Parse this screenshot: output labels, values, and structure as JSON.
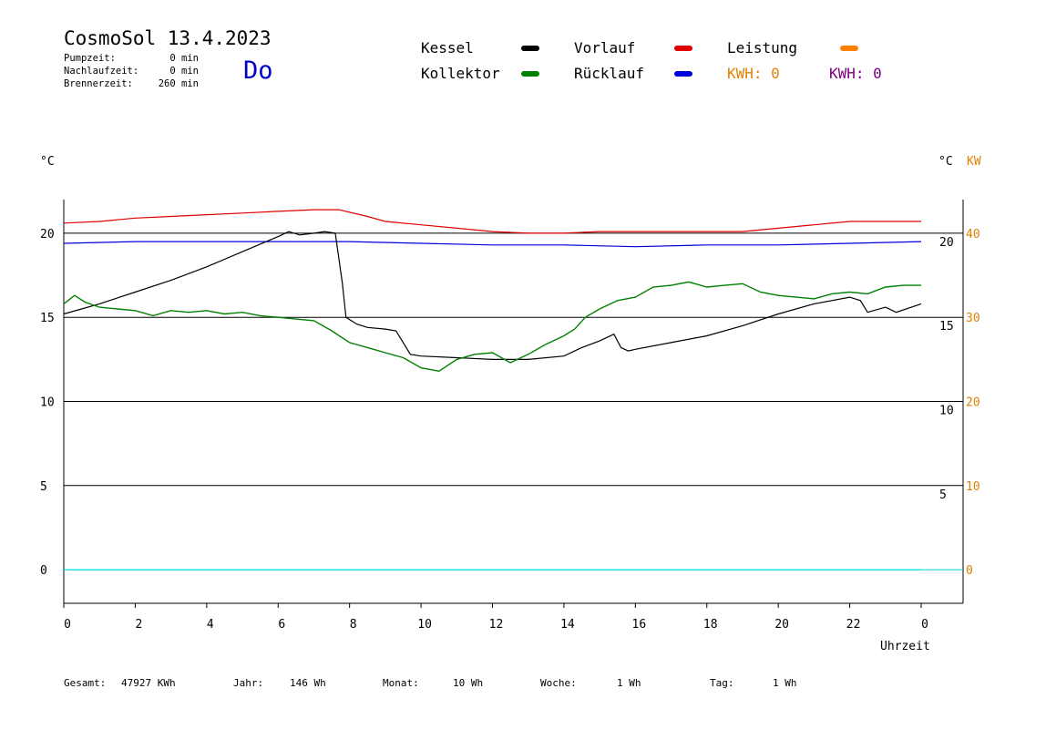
{
  "header": {
    "title": "CosmoSol 13.4.2023",
    "weekday": "Do",
    "stats": [
      {
        "label": "Pumpzeit:",
        "value": "0 min"
      },
      {
        "label": "Nachlaufzeit:",
        "value": "0 min"
      },
      {
        "label": "Brennerzeit:",
        "value": "260 min"
      }
    ]
  },
  "legend": {
    "kessel": {
      "label": "Kessel",
      "color": "#000000"
    },
    "kollektor": {
      "label": "Kollektor",
      "color": "#008000"
    },
    "vorlauf": {
      "label": "Vorlauf",
      "color": "#e00000"
    },
    "ruecklauf": {
      "label": "Rücklauf",
      "color": "#0000dd"
    },
    "leistung": {
      "label": "Leistung",
      "color": "#ff8000"
    },
    "kwh1": {
      "label": "KWH: 0",
      "color": "#e08000"
    },
    "kwh2": {
      "label": "KWH: 0",
      "color": "#800080"
    }
  },
  "footer": {
    "gesamt_label": "Gesamt:",
    "gesamt_value": "47927 KWh",
    "jahr_label": "Jahr:",
    "jahr_value": "146 Wh",
    "monat_label": "Monat:",
    "monat_value": "10 Wh",
    "woche_label": "Woche:",
    "woche_value": "1 Wh",
    "tag_label": "Tag:",
    "tag_value": "1 Wh"
  },
  "chart_data": {
    "type": "line",
    "xlabel": "Uhrzeit",
    "y_left_unit": "°C",
    "y_right_unit": "°C",
    "y_right2_unit": "KW",
    "xlim": [
      0,
      24
    ],
    "ylim": [
      -2,
      22
    ],
    "x_ticks": [
      0,
      2,
      4,
      6,
      8,
      10,
      12,
      14,
      16,
      18,
      20,
      22,
      24
    ],
    "x_tick_labels": [
      "0",
      "2",
      "4",
      "6",
      "8",
      "10",
      "12",
      "14",
      "16",
      "18",
      "20",
      "22",
      "0"
    ],
    "y_left_ticks": [
      0,
      5,
      10,
      15,
      20
    ],
    "y_right_ticks": [
      5,
      10,
      15,
      20
    ],
    "y_right2_ticks": [
      0,
      10,
      20,
      30,
      40
    ],
    "grid_y": [
      0,
      5,
      10,
      15,
      20
    ],
    "series": [
      {
        "name": "Vorlauf",
        "color": "#e00000",
        "x": [
          0,
          1,
          2,
          3,
          4,
          5,
          6,
          7,
          7.7,
          8.5,
          9,
          10,
          11,
          12,
          13,
          14,
          15,
          16,
          17,
          18,
          19,
          20,
          21,
          22,
          23,
          24
        ],
        "y": [
          20.6,
          20.7,
          20.9,
          21.0,
          21.1,
          21.2,
          21.3,
          21.4,
          21.4,
          21.0,
          20.7,
          20.5,
          20.3,
          20.1,
          20.0,
          20.0,
          20.1,
          20.1,
          20.1,
          20.1,
          20.1,
          20.3,
          20.5,
          20.7,
          20.7,
          20.7
        ]
      },
      {
        "name": "Rücklauf",
        "color": "#0000dd",
        "x": [
          0,
          2,
          4,
          6,
          8,
          10,
          12,
          14,
          16,
          18,
          20,
          22,
          24
        ],
        "y": [
          19.4,
          19.5,
          19.5,
          19.5,
          19.5,
          19.4,
          19.3,
          19.3,
          19.2,
          19.3,
          19.3,
          19.4,
          19.5
        ]
      },
      {
        "name": "Kessel",
        "color": "#000000",
        "x": [
          0,
          0.5,
          1,
          2,
          3,
          4,
          5,
          6,
          6.3,
          6.6,
          7,
          7.3,
          7.6,
          7.8,
          7.9,
          8.2,
          8.5,
          9,
          9.3,
          9.5,
          9.7,
          10,
          11,
          12,
          13,
          14,
          14.5,
          15,
          15.4,
          15.6,
          15.8,
          16,
          17,
          18,
          19,
          20,
          21,
          22,
          22.3,
          22.5,
          23,
          23.3,
          24
        ],
        "y": [
          15.2,
          15.5,
          15.8,
          16.5,
          17.2,
          18.0,
          18.9,
          19.8,
          20.1,
          19.9,
          20.0,
          20.1,
          20.0,
          17.0,
          15.0,
          14.6,
          14.4,
          14.3,
          14.2,
          13.5,
          12.8,
          12.7,
          12.6,
          12.5,
          12.5,
          12.7,
          13.2,
          13.6,
          14.0,
          13.2,
          13.0,
          13.1,
          13.5,
          13.9,
          14.5,
          15.2,
          15.8,
          16.2,
          16.0,
          15.3,
          15.6,
          15.3,
          15.8
        ]
      },
      {
        "name": "Kollektor",
        "color": "#008000",
        "x": [
          0,
          0.3,
          0.6,
          1,
          1.5,
          2,
          2.5,
          3,
          3.5,
          4,
          4.5,
          5,
          5.5,
          6,
          6.5,
          7,
          7.5,
          8,
          8.5,
          9,
          9.5,
          10,
          10.5,
          11,
          11.5,
          12,
          12.5,
          13,
          13.5,
          14,
          14.3,
          14.6,
          15,
          15.5,
          16,
          16.5,
          17,
          17.5,
          18,
          18.5,
          19,
          19.5,
          20,
          20.5,
          21,
          21.5,
          22,
          22.5,
          23,
          23.5,
          24
        ],
        "y": [
          15.8,
          16.3,
          15.9,
          15.6,
          15.5,
          15.4,
          15.1,
          15.4,
          15.3,
          15.4,
          15.2,
          15.3,
          15.1,
          15.0,
          14.9,
          14.8,
          14.2,
          13.5,
          13.2,
          12.9,
          12.6,
          12.0,
          11.8,
          12.5,
          12.8,
          12.9,
          12.3,
          12.8,
          13.4,
          13.9,
          14.3,
          15.0,
          15.5,
          16.0,
          16.2,
          16.8,
          16.9,
          17.1,
          16.8,
          16.9,
          17.0,
          16.5,
          16.3,
          16.2,
          16.1,
          16.4,
          16.5,
          16.4,
          16.8,
          16.9,
          16.9
        ]
      },
      {
        "name": "Leistung",
        "color": "#00e0e0",
        "x": [
          0,
          24
        ],
        "y": [
          0,
          0
        ]
      }
    ]
  }
}
